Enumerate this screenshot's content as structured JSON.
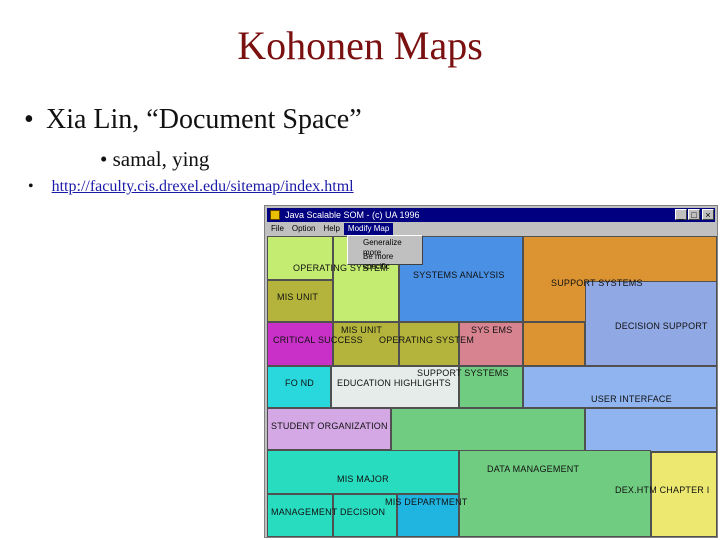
{
  "slide": {
    "title": "Kohonen Maps",
    "bullet1": "Xia Lin, “Document Space”",
    "bullet2": "• samal, ying",
    "bullet3_marker": "•",
    "link": "http://faculty.cis.drexel.edu/sitemap/index.html"
  },
  "window": {
    "title": "Java Scalable SOM - (c) UA 1996",
    "buttons": {
      "minimize": "_",
      "maximize": "□",
      "close": "×"
    },
    "menu": [
      "File",
      "Option",
      "Help",
      "Modify Map"
    ],
    "dropdown": [
      "Generalize more",
      "Be more specific"
    ]
  },
  "map_labels": {
    "operating_system": "OPERATING SYSTEM",
    "systems_analysis": "SYSTEMS ANALYSIS",
    "support_systems_top": "SUPPORT SYSTEMS",
    "decision_support": "DECISION SUPPORT",
    "mis_unit_1": "MIS UNIT",
    "mis_unit_2": "MIS UNIT",
    "critical_success": "CRITICAL SUCCESS",
    "operating_system_2": "OPERATING SYSTEM",
    "sys_ems": "SYS EMS",
    "support_systems_mid": "SUPPORT SYSTEMS",
    "fo_nd": "FO ND",
    "education_highlights": "EDUCATION HIGHLIGHTS",
    "user_interface": "USER INTERFACE",
    "student_organization": "STUDENT ORGANIZATION",
    "data_management": "DATA MANAGEMENT",
    "mis_major": "MIS MAJOR",
    "dexhtm_chapter": "DEX.HTM CHAPTER I",
    "mis_department": "MIS DEPARTMENT",
    "management_decision": "MANAGEMENT DECISION"
  },
  "colors": {
    "title": "#7a1010",
    "titlebar": "#000080",
    "lime": "#c4ec70",
    "olive": "#b4b43c",
    "blue": "#4a90e4",
    "orange": "#dc9432",
    "periwinkle": "#90a8e4",
    "magenta": "#c830c8",
    "pink": "#d88490",
    "cyan": "#28d8dc",
    "light_gray": "#e6ecea",
    "light_blue": "#90b4f0",
    "lavender": "#d4a8e4",
    "teal": "#28dcc0",
    "green": "#70cc80",
    "yellow": "#ece870"
  }
}
